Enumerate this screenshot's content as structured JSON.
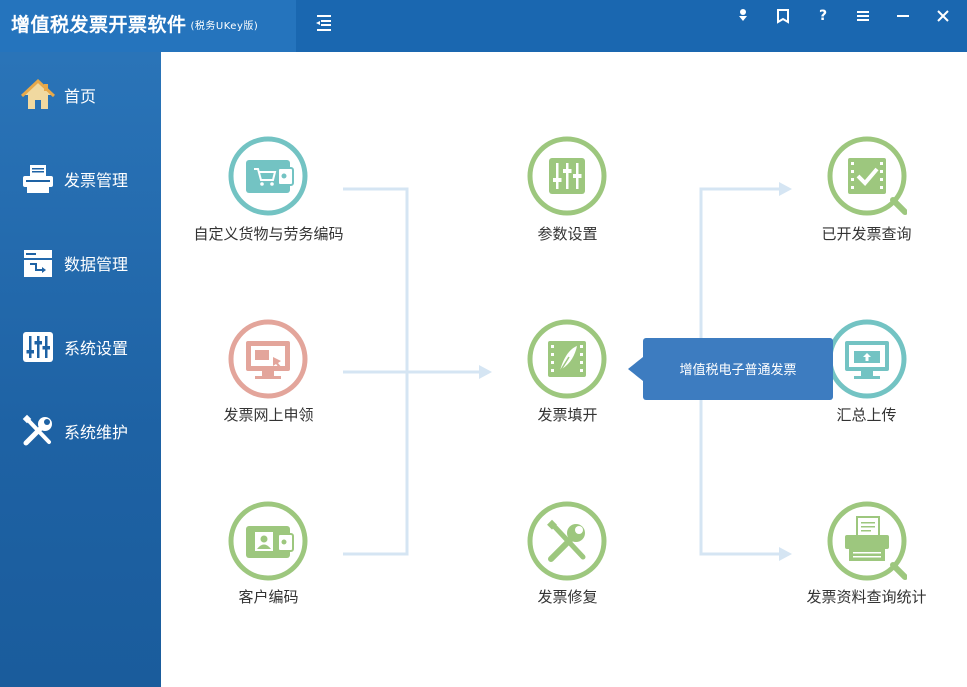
{
  "app": {
    "title": "增值税发票开票软件",
    "subtitle": "(税务UKey版)"
  },
  "titlebar_buttons": [
    {
      "name": "download-icon"
    },
    {
      "name": "bookmark-icon"
    },
    {
      "name": "help-icon",
      "label": "?"
    },
    {
      "name": "menu-icon"
    },
    {
      "name": "minimize-icon"
    },
    {
      "name": "close-icon"
    }
  ],
  "sidebar": {
    "items": [
      {
        "label": "首页",
        "icon": "home-icon"
      },
      {
        "label": "发票管理",
        "icon": "invoice-printer-icon"
      },
      {
        "label": "数据管理",
        "icon": "data-icon"
      },
      {
        "label": "系统设置",
        "icon": "sliders-icon"
      },
      {
        "label": "系统维护",
        "icon": "tools-icon"
      }
    ]
  },
  "nodes": {
    "custom_goods": {
      "label": "自定义货物与劳务编码",
      "icon": "cart-icon"
    },
    "online_apply": {
      "label": "发票网上申领",
      "icon": "monitor-invoice-icon"
    },
    "customer_code": {
      "label": "客户编码",
      "icon": "contact-card-icon"
    },
    "param_settings": {
      "label": "参数设置",
      "icon": "sliders-icon"
    },
    "invoice_issue": {
      "label": "发票填开",
      "icon": "feather-pen-icon"
    },
    "invoice_repair": {
      "label": "发票修复",
      "icon": "tools-icon"
    },
    "issued_query": {
      "label": "已开发票查询",
      "icon": "checked-search-icon"
    },
    "summary_upload": {
      "label": "汇总上传",
      "icon": "upload-monitor-icon"
    },
    "stats_query": {
      "label": "发票资料查询统计",
      "icon": "document-search-icon"
    }
  },
  "tooltip": {
    "text": "增值税电子普通发票"
  },
  "colors": {
    "teal": "#73c3c3",
    "pink": "#e3a59b",
    "green": "#9dc77e",
    "connector": "#d5e5f3",
    "titlebar": "#1a67b0",
    "sidebar": "#1e62a4"
  }
}
